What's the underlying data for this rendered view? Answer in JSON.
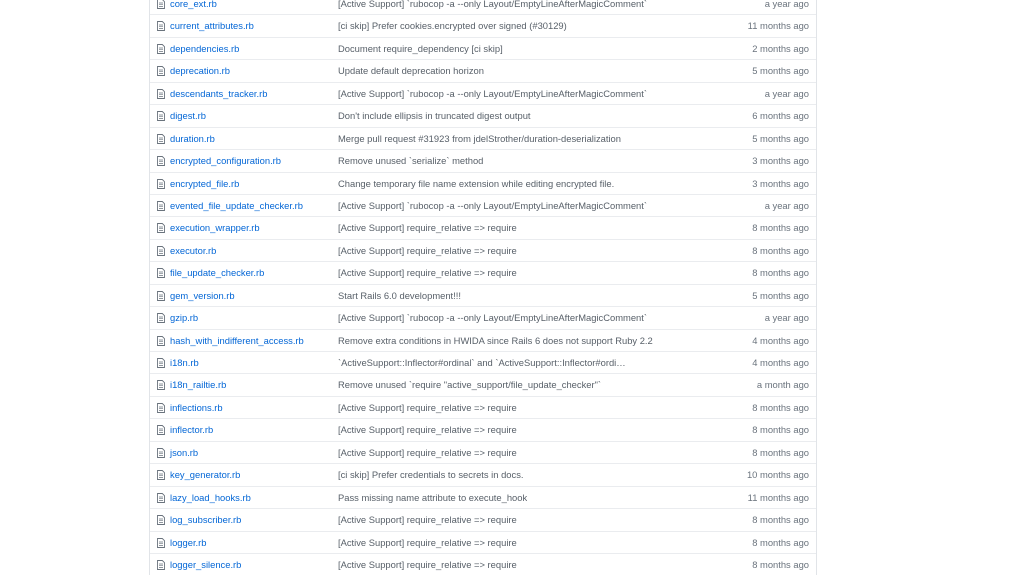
{
  "files": [
    {
      "name": "core_ext.rb",
      "message": "[Active Support] `rubocop -a --only Layout/EmptyLineAfterMagicComment`",
      "age": "a year ago"
    },
    {
      "name": "current_attributes.rb",
      "message": "[ci skip] Prefer cookies.encrypted over signed (#30129)",
      "age": "11 months ago"
    },
    {
      "name": "dependencies.rb",
      "message": "Document require_dependency [ci skip]",
      "age": "2 months ago"
    },
    {
      "name": "deprecation.rb",
      "message": "Update default deprecation horizon",
      "age": "5 months ago"
    },
    {
      "name": "descendants_tracker.rb",
      "message": "[Active Support] `rubocop -a --only Layout/EmptyLineAfterMagicComment`",
      "age": "a year ago"
    },
    {
      "name": "digest.rb",
      "message": "Don't include ellipsis in truncated digest output",
      "age": "6 months ago"
    },
    {
      "name": "duration.rb",
      "message": "Merge pull request #31923 from jdelStrother/duration-deserialization",
      "age": "5 months ago"
    },
    {
      "name": "encrypted_configuration.rb",
      "message": "Remove unused `serialize` method",
      "age": "3 months ago"
    },
    {
      "name": "encrypted_file.rb",
      "message": "Change temporary file name extension while editing encrypted file.",
      "age": "3 months ago"
    },
    {
      "name": "evented_file_update_checker.rb",
      "message": "[Active Support] `rubocop -a --only Layout/EmptyLineAfterMagicComment`",
      "age": "a year ago"
    },
    {
      "name": "execution_wrapper.rb",
      "message": "[Active Support] require_relative => require",
      "age": "8 months ago"
    },
    {
      "name": "executor.rb",
      "message": "[Active Support] require_relative => require",
      "age": "8 months ago"
    },
    {
      "name": "file_update_checker.rb",
      "message": "[Active Support] require_relative => require",
      "age": "8 months ago"
    },
    {
      "name": "gem_version.rb",
      "message": "Start Rails 6.0 development!!!",
      "age": "5 months ago"
    },
    {
      "name": "gzip.rb",
      "message": "[Active Support] `rubocop -a --only Layout/EmptyLineAfterMagicComment`",
      "age": "a year ago"
    },
    {
      "name": "hash_with_indifferent_access.rb",
      "message": "Remove extra conditions in HWIDA since Rails 6 does not support Ruby 2.2",
      "age": "4 months ago"
    },
    {
      "name": "i18n.rb",
      "message": "`ActiveSupport::Inflector#ordinal` and `ActiveSupport::Inflector#ordi…",
      "age": "4 months ago"
    },
    {
      "name": "i18n_railtie.rb",
      "message": "Remove unused `require \"active_support/file_update_checker\"`",
      "age": "a month ago"
    },
    {
      "name": "inflections.rb",
      "message": "[Active Support] require_relative => require",
      "age": "8 months ago"
    },
    {
      "name": "inflector.rb",
      "message": "[Active Support] require_relative => require",
      "age": "8 months ago"
    },
    {
      "name": "json.rb",
      "message": "[Active Support] require_relative => require",
      "age": "8 months ago"
    },
    {
      "name": "key_generator.rb",
      "message": "[ci skip] Prefer credentials to secrets in docs.",
      "age": "10 months ago"
    },
    {
      "name": "lazy_load_hooks.rb",
      "message": "Pass missing name attribute to execute_hook",
      "age": "11 months ago"
    },
    {
      "name": "log_subscriber.rb",
      "message": "[Active Support] require_relative => require",
      "age": "8 months ago"
    },
    {
      "name": "logger.rb",
      "message": "[Active Support] require_relative => require",
      "age": "8 months ago"
    },
    {
      "name": "logger_silence.rb",
      "message": "[Active Support] require_relative => require",
      "age": "8 months ago"
    }
  ],
  "icons": {
    "file": "file-text-icon",
    "color": "#6a737d"
  },
  "colors": {
    "link": "#0366d6",
    "message": "#586069",
    "age": "#6a737d",
    "border": "#e1e4e8"
  }
}
